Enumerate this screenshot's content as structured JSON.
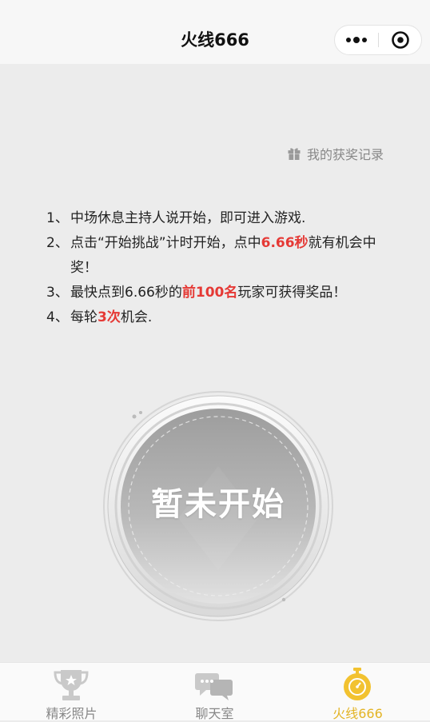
{
  "header": {
    "title": "火线666"
  },
  "record_link": {
    "label": "我的获奖记录"
  },
  "rules": [
    {
      "num": "1、",
      "parts": [
        {
          "t": "中场休息主持人说开始，即可进入游戏."
        }
      ]
    },
    {
      "num": "2、",
      "parts": [
        {
          "t": "点击“开始挑战”计时开始，点中"
        },
        {
          "t": "6.66秒",
          "hl": true
        },
        {
          "t": "就有机会中奖！"
        }
      ]
    },
    {
      "num": "3、",
      "parts": [
        {
          "t": "最快点到6.66秒的"
        },
        {
          "t": "前100名",
          "hl": true
        },
        {
          "t": "玩家可获得奖品！"
        }
      ]
    },
    {
      "num": "4、",
      "parts": [
        {
          "t": "每轮"
        },
        {
          "t": "3次",
          "hl": true
        },
        {
          "t": "机会."
        }
      ]
    }
  ],
  "main_button": {
    "label": "暂未开始"
  },
  "tabbar": {
    "tabs": [
      {
        "label": "精彩照片",
        "icon": "trophy-icon",
        "active": false
      },
      {
        "label": "聊天室",
        "icon": "chat-bubbles-icon",
        "active": false
      },
      {
        "label": "火线666",
        "icon": "stopwatch-icon",
        "active": true
      }
    ]
  },
  "colors": {
    "highlight": "#e53935",
    "active_tab": "#e3b425",
    "inactive_tab": "#888888"
  }
}
